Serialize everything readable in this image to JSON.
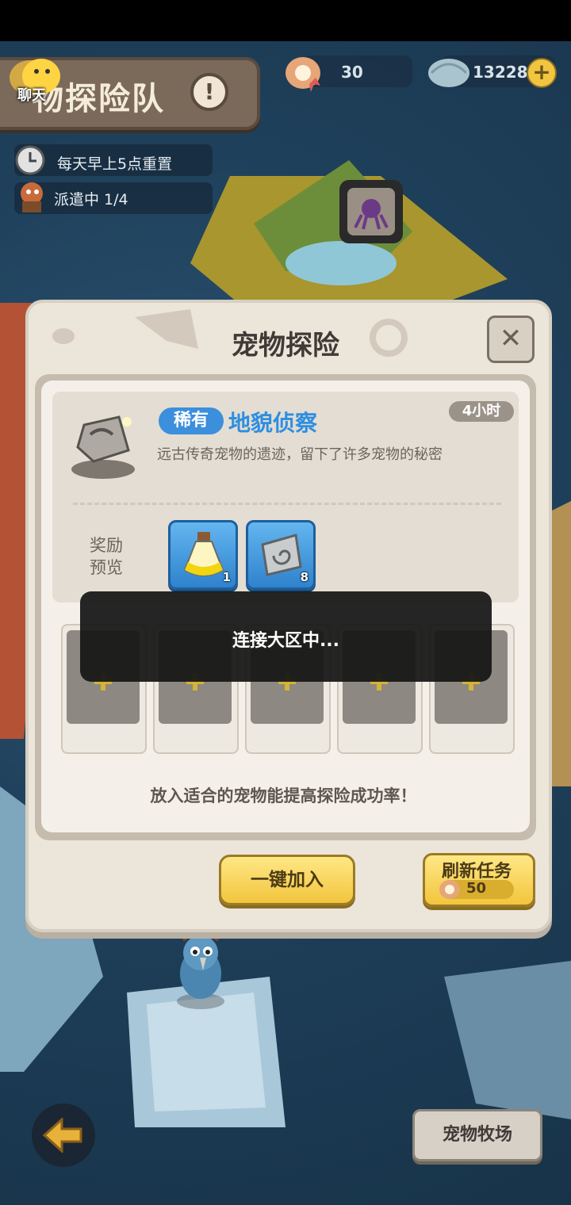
{
  "header": {
    "chat_label": "聊天",
    "title": "物探险队",
    "info_symbol": "!"
  },
  "currency": {
    "pearls": "30",
    "shells": "13228",
    "add_symbol": "+"
  },
  "status": {
    "reset_text": "每天早上5点重置",
    "dispatch_text": "派遣中 1/4"
  },
  "dialog": {
    "title": "宠物探险",
    "close_symbol": "✕",
    "task": {
      "rarity": "稀有",
      "name": "地貌侦察",
      "duration": "4小时",
      "description": "远古传奇宠物的遗迹，留下了许多宠物的秘密"
    },
    "reward_label": "奖励预览",
    "rewards": [
      {
        "icon": "exp-potion-icon",
        "count": "1"
      },
      {
        "icon": "fossil-icon",
        "count": "8"
      }
    ],
    "pet_slot_count": 5,
    "hint": "放入适合的宠物能提高探险成功率！",
    "join_button": "一键加入",
    "refresh_button": "刷新任务",
    "refresh_cost": "50"
  },
  "toast": {
    "text": "连接大区中..."
  },
  "bottom": {
    "ranch_button": "宠物牧场"
  },
  "colors": {
    "accent_blue": "#3b8fdc",
    "button_yellow": "#f2c53d",
    "panel": "#ece5da"
  }
}
